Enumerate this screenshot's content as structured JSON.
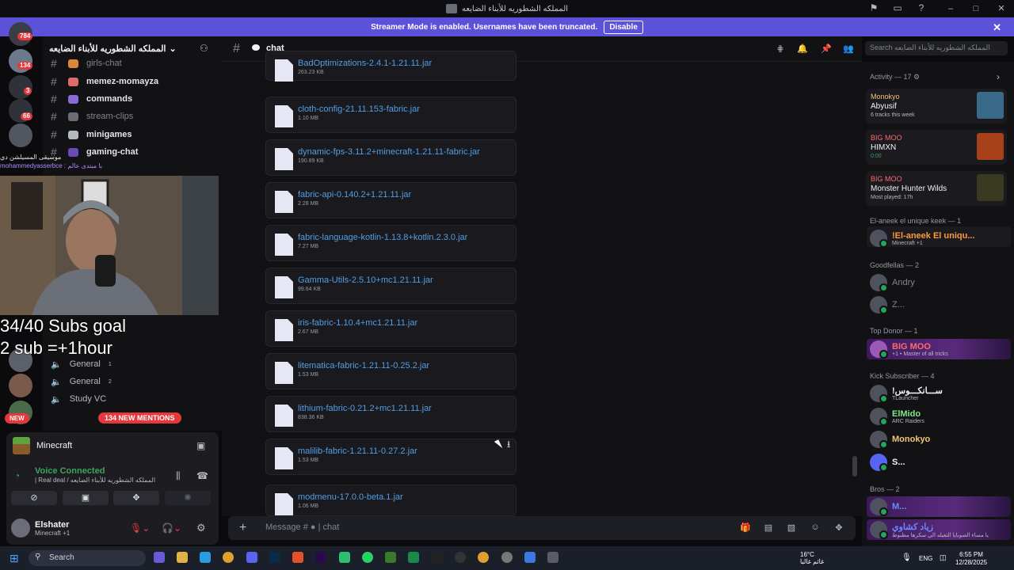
{
  "window": {
    "title": "المملكه الشطوريه للأبناء الضايعه"
  },
  "banner": {
    "text": "Streamer Mode is enabled. Usernames have been truncated.",
    "disable": "Disable"
  },
  "server_badges": [
    "784",
    "134",
    "3",
    "66"
  ],
  "sidebar": {
    "server_name": "المملكه الشطوريه للأبناء الضايعه",
    "channels": [
      {
        "name": "girls-chat",
        "dim": true
      },
      {
        "name": "memez-momayza"
      },
      {
        "name": "commands"
      },
      {
        "name": "stream-clips",
        "dim": true
      },
      {
        "name": "minigames"
      },
      {
        "name": "gaming-chat"
      }
    ],
    "voice": [
      "General",
      "General",
      "Study VC"
    ],
    "voice_counts": [
      "1",
      "2"
    ],
    "new_label": "NEW",
    "mentions": "134 NEW MENTIONS"
  },
  "overlay": {
    "goal_line1": "34/40 Subs goal",
    "goal_line2": "2 sub =+1hour",
    "name_line1": "موسيقى المسيلشن دي",
    "name_line2": "mohammedyasserbce : با مبتدی عالم"
  },
  "activity_panel": {
    "game": "Minecraft",
    "voice_status": "Voice Connected",
    "voice_sub": "| Real deal / المملكه الشطوريه للأبناء الضايعه"
  },
  "user": {
    "name": "Elshater",
    "status": "Minecraft +1"
  },
  "header": {
    "channel": "chat",
    "search_placeholder": "Search المملكه الشطوريه للأبناء الضايعه"
  },
  "files": [
    {
      "name": "BadOptimizations-2.4.1-1.21.11.jar",
      "size": "263.23 KB"
    },
    {
      "name": "cloth-config-21.11.153-fabric.jar",
      "size": "1.10 MB"
    },
    {
      "name": "dynamic-fps-3.11.2+minecraft-1.21.11-fabric.jar",
      "size": "190.89 KB"
    },
    {
      "name": "fabric-api-0.140.2+1.21.11.jar",
      "size": "2.28 MB"
    },
    {
      "name": "fabric-language-kotlin-1.13.8+kotlin.2.3.0.jar",
      "size": "7.27 MB"
    },
    {
      "name": "Gamma-Utils-2.5.10+mc1.21.11.jar",
      "size": "99.64 KB"
    },
    {
      "name": "iris-fabric-1.10.4+mc1.21.11.jar",
      "size": "2.67 MB"
    },
    {
      "name": "litematica-fabric-1.21.11-0.25.2.jar",
      "size": "1.53 MB"
    },
    {
      "name": "lithium-fabric-0.21.2+mc1.21.11.jar",
      "size": "838.36 KB"
    },
    {
      "name": "malilib-fabric-1.21.11-0.27.2.jar",
      "size": "1.53 MB"
    },
    {
      "name": "modmenu-17.0.0-beta.1.jar",
      "size": "1.06 MB"
    }
  ],
  "composer": {
    "placeholder": "Message #",
    "channel": "| chat"
  },
  "members": {
    "activity_title": "Activity — 17",
    "cards": [
      {
        "user": "Monokyo",
        "title": "Abyusif",
        "sub": "6 tracks this week"
      },
      {
        "user": "BIG MOO",
        "title": "HIMXN",
        "sub": "0:00"
      },
      {
        "user": "BIG MOO",
        "title": "Monster Hunter Wilds",
        "sub": "Most played: 17h"
      }
    ],
    "sections": [
      {
        "title": "El-aneek el unique keek — 1",
        "members": [
          {
            "name": "!El-aneek El uniqu...",
            "sub": "Minecraft +1",
            "color": "#ff9a3c"
          }
        ]
      },
      {
        "title": "Goodfellas — 2",
        "members": [
          {
            "name": "Andry",
            "sub": "",
            "color": "#80848e"
          },
          {
            "name": "Z...",
            "sub": "",
            "color": "#80848e"
          }
        ]
      },
      {
        "title": "Top Donor — 1",
        "members": [
          {
            "name": "BIG MOO",
            "sub": "+1 • Master of all tricks",
            "color": "#ff6b6b"
          }
        ]
      },
      {
        "title": "Kick Subscriber — 4",
        "members": [
          {
            "name": "!ســـانكـــوس",
            "sub": "TLauncher",
            "color": "#f2f3f5"
          },
          {
            "name": "ElMido",
            "sub": "ARC Raiders",
            "color": "#7ee787"
          },
          {
            "name": "Monokyo",
            "sub": "",
            "color": "#f0c674"
          },
          {
            "name": "S...",
            "sub": "",
            "color": "#f2f3f5"
          }
        ]
      },
      {
        "title": "Bros — 2",
        "members": [
          {
            "name": "M...",
            "sub": "",
            "color": "#6a8cff"
          },
          {
            "name": "زياد كشاوي",
            "sub": "يا مساء الصوبايا التعيله الي سكرها مطبوط",
            "color": "#6a8cff"
          }
        ]
      }
    ]
  },
  "taskbar": {
    "search": "Search",
    "temp": "16°C",
    "weather": "غائم غالبا",
    "lang": "ENG",
    "time": "6:55 PM",
    "date": "12/28/2025"
  }
}
